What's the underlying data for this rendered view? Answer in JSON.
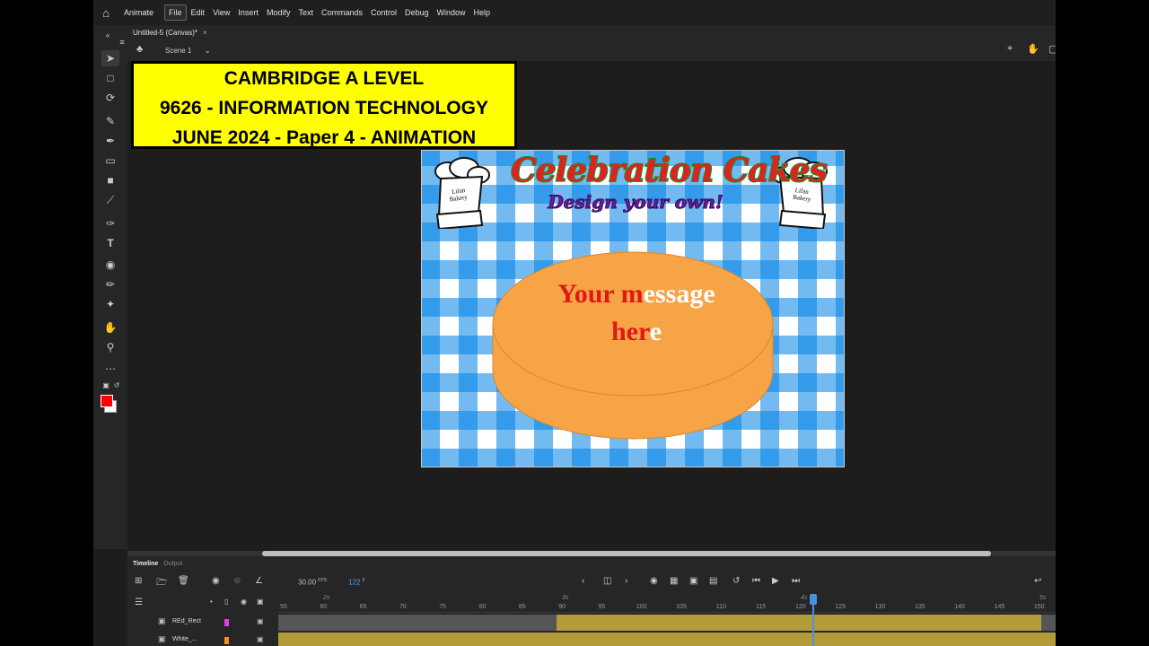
{
  "menubar": {
    "app_name": "Animate",
    "items": [
      "File",
      "Edit",
      "View",
      "Insert",
      "Modify",
      "Text",
      "Commands",
      "Control",
      "Debug",
      "Window",
      "Help"
    ]
  },
  "document": {
    "tab_title": "Untitled-5 (Canvas)*",
    "close_glyph": "×",
    "scene": "Scene 1"
  },
  "banner": {
    "line1": "CAMBRIDGE A LEVEL",
    "line2": "9626 - INFORMATION TECHNOLOGY",
    "line3": "JUNE 2024 - Paper 4 - ANIMATION"
  },
  "stage": {
    "title": "Celebration Cakes",
    "subtitle": "Design your own!",
    "hat_label_line1": "Lifan",
    "hat_label_line2": "Bakery",
    "message_red_1": "Your m",
    "message_white_1": "essage",
    "message_red_2": "her",
    "message_white_2": "e",
    "colors": {
      "cake": "#f6a445",
      "message_red": "#e01818",
      "check_blue": "#3aa6ff"
    }
  },
  "timeline": {
    "tab_timeline": "Timeline",
    "tab_output": "Output",
    "fps_value": "30.00",
    "fps_unit": "FPS",
    "current_frame": "122",
    "frame_unit": "F",
    "ruler_ticks": [
      "55",
      "60",
      "65",
      "70",
      "75",
      "80",
      "85",
      "90",
      "95",
      "100",
      "105",
      "110",
      "115",
      "120",
      "125",
      "130",
      "135",
      "140",
      "145",
      "150"
    ],
    "seconds": [
      "2s",
      "3s",
      "4s",
      "5s"
    ],
    "layers": [
      {
        "name": "REd_Rect",
        "color": "#e040e0"
      },
      {
        "name": "White_...",
        "color": "#ff8c1a"
      }
    ]
  }
}
